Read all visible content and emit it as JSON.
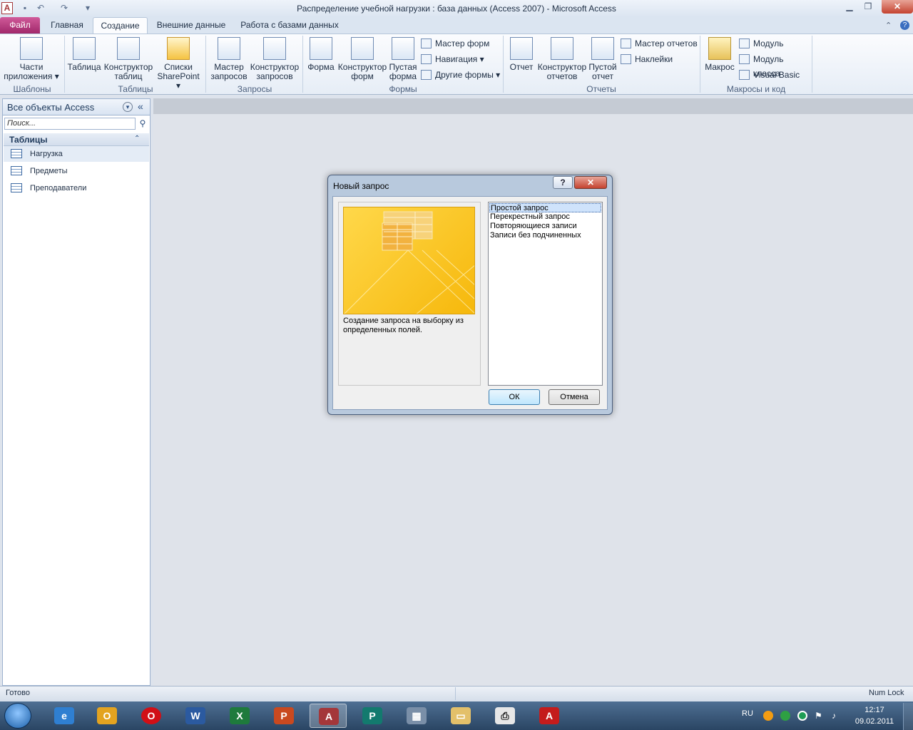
{
  "window": {
    "title": "Распределение учебной нагрузки : база данных (Access 2007)  -  Microsoft Access"
  },
  "tabs": {
    "file": "Файл",
    "home": "Главная",
    "create": "Создание",
    "external": "Внешние данные",
    "dbtools": "Работа с базами данных"
  },
  "ribbon": {
    "templates": {
      "label": "Шаблоны",
      "parts": "Части приложения ▾"
    },
    "tables": {
      "label": "Таблицы",
      "table": "Таблица",
      "designer": "Конструктор таблиц",
      "sharepoint": "Списки SharePoint ▾"
    },
    "queries": {
      "label": "Запросы",
      "wizard": "Мастер запросов",
      "designer": "Конструктор запросов"
    },
    "forms": {
      "label": "Формы",
      "form": "Форма",
      "designer": "Конструктор форм",
      "blank": "Пустая форма",
      "wizard": "Мастер форм",
      "navigation": "Навигация ▾",
      "more": "Другие формы ▾"
    },
    "reports": {
      "label": "Отчеты",
      "report": "Отчет",
      "designer": "Конструктор отчетов",
      "blank": "Пустой отчет",
      "wizard": "Мастер отчетов",
      "labels": "Наклейки"
    },
    "macros": {
      "label": "Макросы и код",
      "macro": "Макрос",
      "module": "Модуль",
      "class_module": "Модуль класса",
      "vb": "Visual Basic"
    }
  },
  "nav": {
    "title": "Все объекты Access",
    "search_placeholder": "Поиск...",
    "group": "Таблицы",
    "items": [
      "Нагрузка",
      "Предметы",
      "Преподаватели"
    ]
  },
  "dialog": {
    "title": "Новый запрос",
    "description": "Создание запроса на выборку из определенных полей.",
    "options": [
      "Простой запрос",
      "Перекрестный запрос",
      "Повторяющиеся записи",
      "Записи без подчиненных"
    ],
    "ok": "ОК",
    "cancel": "Отмена"
  },
  "status": {
    "left": "Готово",
    "right": "Num Lock"
  },
  "taskbar": {
    "lang": "RU",
    "time": "12:17",
    "date": "09.02.2011"
  },
  "colors": {
    "file_tab": "#b8347f",
    "ribbon_bg": "#f4f7fb",
    "workarea": "#dfe3ea",
    "taskbar": "#3b5a7c"
  }
}
